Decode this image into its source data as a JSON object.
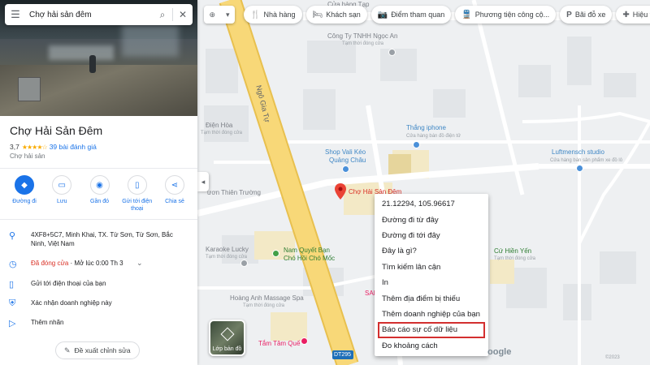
{
  "search": {
    "value": "Chợ hải sản đêm"
  },
  "place": {
    "name": "Chợ Hải Sản Đêm",
    "rating": "3,7",
    "stars": "★★★★☆",
    "reviews": "39 bài đánh giá",
    "category": "Chợ hải sản"
  },
  "actions": [
    {
      "label": "Đường đi",
      "icon": "directions-icon"
    },
    {
      "label": "Lưu",
      "icon": "bookmark-icon"
    },
    {
      "label": "Gần đó",
      "icon": "nearby-icon"
    },
    {
      "label": "Gửi tới điện thoại",
      "icon": "send-to-phone-icon"
    },
    {
      "label": "Chia sẻ",
      "icon": "share-icon"
    }
  ],
  "info": {
    "address": "4XF8+5C7, Minh Khai, TX. Từ Sơn, Từ Sơn, Bắc Ninh, Việt Nam",
    "status_closed": "Đã đóng cửa",
    "status_open": " · Mở lúc 0:00 Th 3",
    "send_phone": "Gửi tới điện thoại của bạn",
    "claim": "Xác nhận doanh nghiệp này",
    "label": "Thêm nhãn"
  },
  "suggest_edit": "Đề xuất chỉnh sửa",
  "chips": [
    {
      "label": "Nhà hàng",
      "icon": "restaurant-icon"
    },
    {
      "label": "Khách sạn",
      "icon": "hotel-icon"
    },
    {
      "label": "Điểm tham quan",
      "icon": "attraction-icon"
    },
    {
      "label": "Phương tiện công cộ...",
      "icon": "transit-icon"
    },
    {
      "label": "Bãi đỗ xe",
      "icon": "parking-icon"
    },
    {
      "label": "Hiệu thuốc",
      "icon": "pharmacy-icon"
    }
  ],
  "map": {
    "road_name": "Ngô Gia Tự",
    "road_code": "DT295",
    "layers_label": "Lớp bản đồ",
    "pois": {
      "cua_hang_tap": "Cửa hàng Tạp",
      "ngoc_an": "Công Ty TNHH Ngọc An",
      "ngoc_an_sub": "Tạm thời đóng cửa",
      "dien_hoa": "Điện Hòa",
      "dien_hoa_sub": "Tạm thời đóng cửa",
      "thang_iphone": "Thắng iphone",
      "thang_iphone_sub": "Cửa hàng bán đồ điện tử",
      "shop_vali": "Shop Vali Kéo",
      "shop_vali_2": "Quảng Châu",
      "luftmensch": "Luftmensch studio",
      "luftmensch_sub": "Cửa hàng bán sản phẩm xe đồ lô",
      "thien_truong": "ươn Thiên Trường",
      "cho_hai_san": "Chợ Hải Sản Đêm",
      "karaoke": "Karaoke Lucky",
      "karaoke_sub": "Tạm thời đóng cửa",
      "nam_quyet": "Nam Quyết Bạn",
      "nam_quyet_2": "Chó Hồi Chó Mốc",
      "hoang_anh": "Hoàng Anh Massage Spa",
      "hoang_anh_sub": "Tạm thời đóng cửa",
      "tam_tam": "Tắm Tâm Quế",
      "hien_yen": "Cứ Hiền Yến",
      "hien_yen_sub": "Tạm thời đóng cửa",
      "sal": "SAI"
    },
    "google": "oogle",
    "copyright": "©2023"
  },
  "context_menu": [
    "21.12294, 105.96617",
    "Đường đi từ đây",
    "Đường đi tới đây",
    "Đây là gì?",
    "Tìm kiếm lân cận",
    "In",
    "Thêm địa điểm bị thiếu",
    "Thêm doanh nghiệp của bạn",
    "Báo cáo sự cố dữ liệu",
    "Đo khoảng cách"
  ],
  "colors": {
    "accent": "#1a73e8",
    "road": "#f7d774",
    "closed": "#d93025",
    "highlight": "#d32f2f",
    "marker": "#ea4335"
  }
}
